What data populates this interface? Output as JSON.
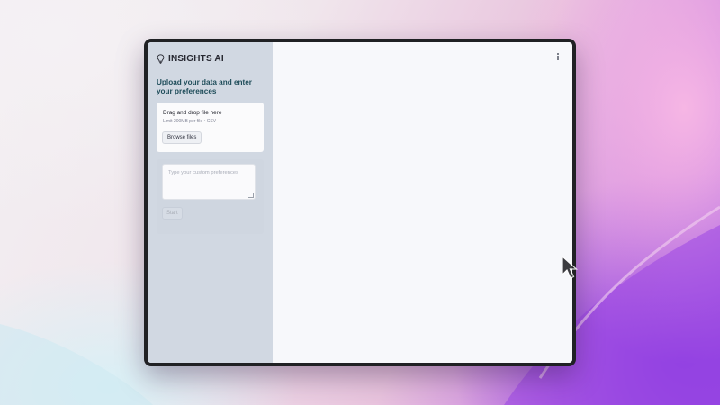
{
  "app": {
    "title": "INSIGHTS AI",
    "icon": "lightbulb-icon"
  },
  "sidebar": {
    "heading": "Upload your data and enter your preferences",
    "uploader": {
      "drop_label": "Drag and drop file here",
      "limit_text": "Limit 200MB per file • CSV",
      "browse_label": "Browse files"
    },
    "preferences": {
      "placeholder": "Type your custom preferences",
      "value": ""
    },
    "start_label": "Start"
  },
  "main": {
    "menu_icon": "kebab-menu-icon"
  },
  "colors": {
    "sidebar_bg": "#d1d8e2",
    "main_bg": "#f7f8fb",
    "heading_text": "#1f4d5a",
    "device_frame": "#202124"
  }
}
